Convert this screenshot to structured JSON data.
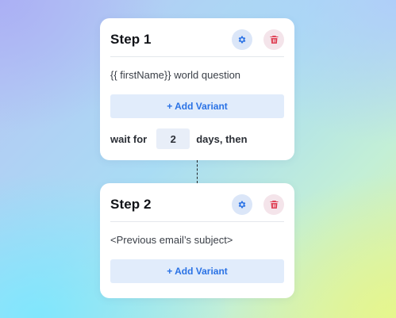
{
  "steps": [
    {
      "title": "Step 1",
      "subject": "{{ firstName}} world question",
      "add_variant_label": "+ Add Variant",
      "wait": {
        "prefix": "wait for",
        "value": "2",
        "suffix": "days, then"
      }
    },
    {
      "title": "Step 2",
      "subject": "<Previous email’s subject>",
      "add_variant_label": "+ Add Variant"
    }
  ],
  "icons": {
    "settings": "gear-icon",
    "delete": "trash-icon"
  },
  "colors": {
    "accent": "#2a72e5",
    "delete": "#e0465a",
    "variant_bg": "#e1ecfb"
  }
}
